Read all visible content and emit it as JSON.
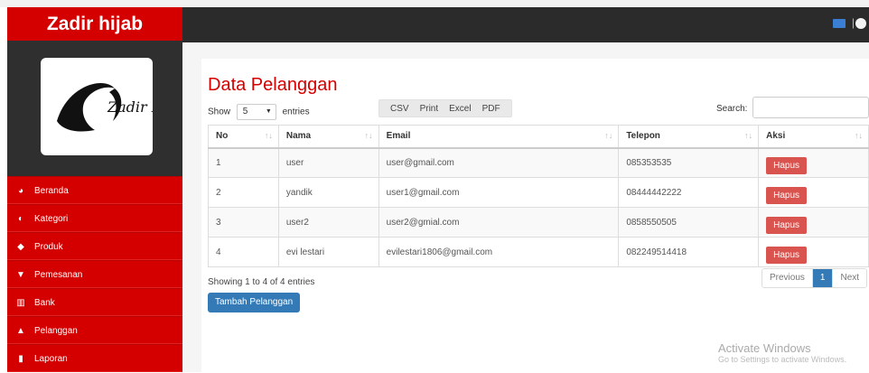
{
  "brand": "Zadir hijab",
  "logo": {
    "text": "Zadir Hijab collection"
  },
  "sidebar": {
    "items": [
      {
        "label": "Beranda",
        "icon": "dashboard-icon"
      },
      {
        "label": "Kategori",
        "icon": "tag-icon"
      },
      {
        "label": "Produk",
        "icon": "product-icon"
      },
      {
        "label": "Pemesanan",
        "icon": "cart-icon"
      },
      {
        "label": "Bank",
        "icon": "bank-icon"
      },
      {
        "label": "Pelanggan",
        "icon": "user-icon"
      },
      {
        "label": "Laporan",
        "icon": "file-icon"
      }
    ]
  },
  "topbar": {
    "separator": "|"
  },
  "page": {
    "title": "Data Pelanggan",
    "show_label": "Show",
    "show_value": "5",
    "entries_label": "entries",
    "export_buttons": [
      "CSV",
      "Print",
      "Excel",
      "PDF"
    ],
    "search_label": "Search:",
    "search_value": ""
  },
  "table": {
    "headers": [
      "No",
      "Nama",
      "Email",
      "Telepon",
      "Aksi"
    ],
    "rows": [
      {
        "no": "1",
        "nama": "user",
        "email": "user@gmail.com",
        "telepon": "085353535",
        "aksi": "Hapus"
      },
      {
        "no": "2",
        "nama": "yandik",
        "email": "user1@gmail.com",
        "telepon": "08444442222",
        "aksi": "Hapus"
      },
      {
        "no": "3",
        "nama": "user2",
        "email": "user2@gmial.com",
        "telepon": "0858550505",
        "aksi": "Hapus"
      },
      {
        "no": "4",
        "nama": "evi lestari",
        "email": "evilestari1806@gmail.com",
        "telepon": "082249514418",
        "aksi": "Hapus"
      }
    ]
  },
  "footer": {
    "info": "Showing 1 to 4 of 4 entries",
    "previous": "Previous",
    "page": "1",
    "next": "Next",
    "add_button": "Tambah Pelanggan"
  },
  "watermark": {
    "line1": "Activate Windows",
    "line2": "Go to Settings to activate Windows."
  },
  "colors": {
    "accent": "#d40000",
    "primary": "#337ab7",
    "danger": "#d9534f",
    "dark": "#2b2b2b"
  }
}
